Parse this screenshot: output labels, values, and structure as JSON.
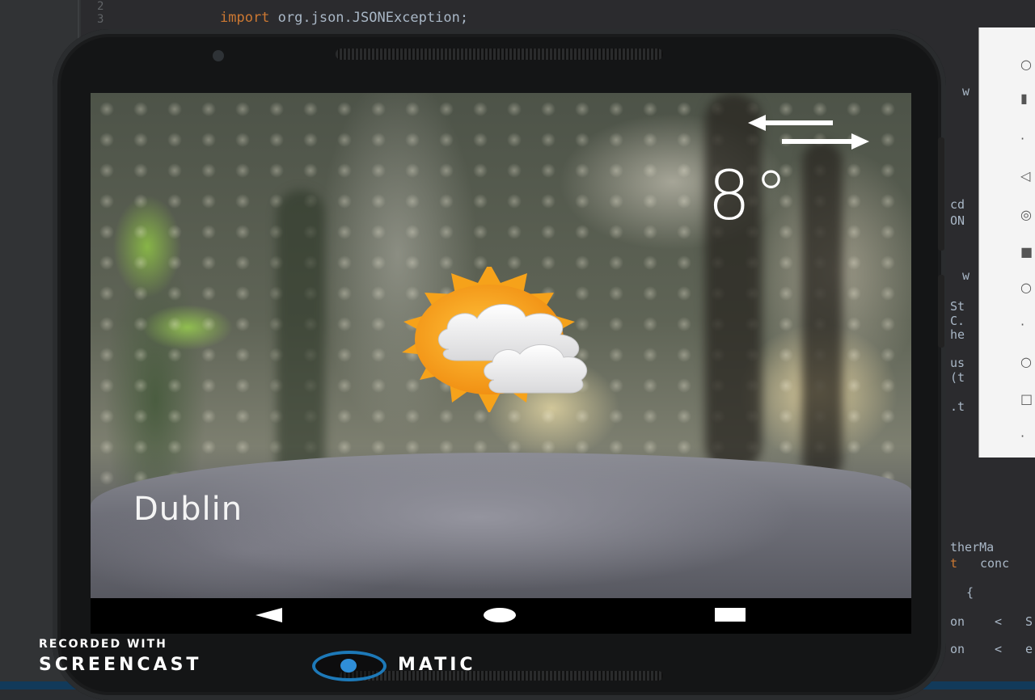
{
  "ide": {
    "line_numbers": [
      "2",
      "3"
    ],
    "import_keyword": "import",
    "import_rest": " org.json.JSONException;",
    "fragments": [
      "w",
      "cd",
      "ON",
      "w",
      "St",
      "C.",
      "he",
      "us",
      "(t",
      ".t",
      "therMa",
      "t",
      "conc",
      "{",
      "on",
      "<",
      "S",
      "on",
      "<",
      "e"
    ]
  },
  "app": {
    "temperature": "8°",
    "city": "Dublin",
    "weather_condition": "partly-cloudy-day-icon",
    "toggle_icon": "swap-arrows-icon"
  },
  "navbar": {
    "back": "back-icon",
    "home": "home-icon",
    "recent": "recent-apps-icon"
  },
  "watermark": {
    "recorded": "RECORDED WITH",
    "brand_left": "SCREENCAST",
    "brand_right": "MATIC"
  },
  "colors": {
    "sun": "#f6a21a",
    "cloud": "#f2f2f2",
    "ide_keyword": "#cc7832",
    "ide_text": "#a9b7c6"
  }
}
